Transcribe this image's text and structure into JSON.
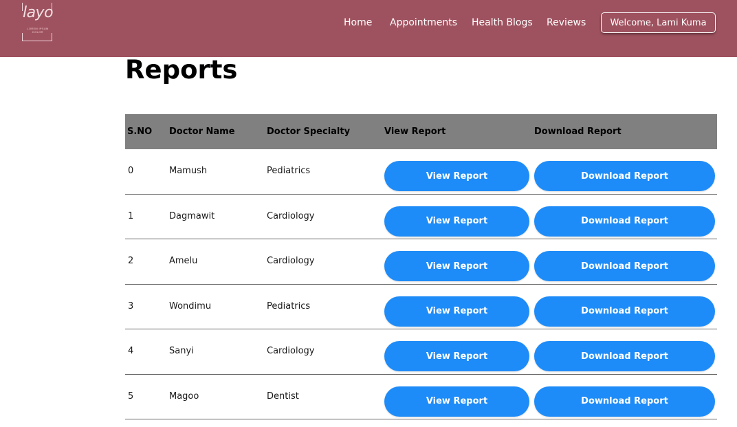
{
  "brand": {
    "logo_word": "layo",
    "logo_tagline": "LOREM IPSUM DOLOR"
  },
  "nav": {
    "items": [
      {
        "label": "Home"
      },
      {
        "label": "Appointments"
      },
      {
        "label": "Health Blogs"
      },
      {
        "label": "Reviews"
      }
    ],
    "welcome_label": "Welcome, Lami Kuma"
  },
  "page": {
    "title": "Reports"
  },
  "table": {
    "headers": {
      "sno": "S.NO",
      "doctor_name": "Doctor Name",
      "specialty": "Doctor Specialty",
      "view": "View Report",
      "download": "Download Report"
    },
    "rows": [
      {
        "sno": "0",
        "name": "Mamush",
        "specialty": "Pediatrics",
        "view_label": "View Report",
        "download_label": "Download Report"
      },
      {
        "sno": "1",
        "name": "Dagmawit",
        "specialty": "Cardiology",
        "view_label": "View Report",
        "download_label": "Download Report"
      },
      {
        "sno": "2",
        "name": "Amelu",
        "specialty": "Cardiology",
        "view_label": "View Report",
        "download_label": "Download Report"
      },
      {
        "sno": "3",
        "name": "Wondimu",
        "specialty": "Pediatrics",
        "view_label": "View Report",
        "download_label": "Download Report"
      },
      {
        "sno": "4",
        "name": "Sanyi",
        "specialty": "Cardiology",
        "view_label": "View Report",
        "download_label": "Download Report"
      },
      {
        "sno": "5",
        "name": "Magoo",
        "specialty": "Dentist",
        "view_label": "View Report",
        "download_label": "Download Report"
      }
    ]
  },
  "colors": {
    "navbar": "#9e525f",
    "table_header": "#808080",
    "button": "#1e8cf8"
  }
}
